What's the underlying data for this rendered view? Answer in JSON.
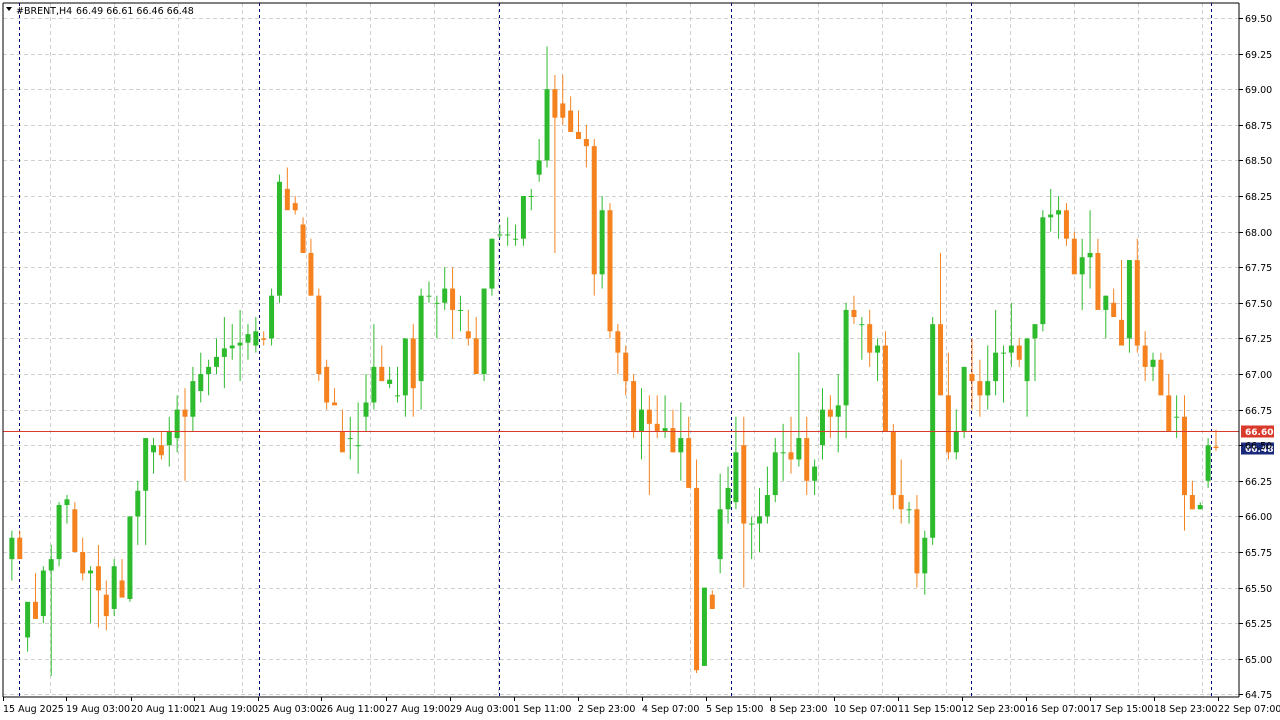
{
  "header": {
    "symbol_info": "#BRENT,H4",
    "ohlc": "66.49 66.61 66.46 66.48"
  },
  "colors": {
    "background": "#ffffff",
    "grid": "#d0d0d0",
    "bull": "#2dbb2d",
    "bear": "#f5821f",
    "separator": "#000080",
    "ask_line": "#d93a2b",
    "bid_tag": "#1a2a7a"
  },
  "price_tags": {
    "ask": "66.60",
    "bid": "66.48"
  },
  "chart_data": {
    "type": "candlestick",
    "title": "#BRENT,H4",
    "ylim": [
      64.7,
      69.6
    ],
    "grid": true,
    "y_ticks": [
      "69.50",
      "69.25",
      "69.00",
      "68.75",
      "68.50",
      "68.25",
      "68.00",
      "67.75",
      "67.50",
      "67.25",
      "67.00",
      "66.75",
      "66.50",
      "66.25",
      "66.00",
      "65.75",
      "65.50",
      "65.25",
      "65.00",
      "64.75"
    ],
    "x_labels": [
      "15 Aug 2025",
      "19 Aug 03:00",
      "20 Aug 11:00",
      "21 Aug 19:00",
      "25 Aug 03:00",
      "26 Aug 11:00",
      "27 Aug 19:00",
      "29 Aug 03:00",
      "1 Sep 11:00",
      "2 Sep 23:00",
      "4 Sep 07:00",
      "5 Sep 15:00",
      "8 Sep 23:00",
      "10 Sep 07:00",
      "11 Sep 15:00",
      "12 Sep 23:00",
      "16 Sep 07:00",
      "17 Sep 15:00",
      "18 Sep 23:00",
      "22 Sep 07:00"
    ],
    "ask_price": 66.6,
    "bid_price": 66.48,
    "candles": [
      [
        65.7,
        65.9,
        65.55,
        65.85
      ],
      [
        65.85,
        65.9,
        65.7,
        65.7
      ],
      [
        65.15,
        65.4,
        65.05,
        65.4
      ],
      [
        65.4,
        65.6,
        65.35,
        65.28
      ],
      [
        65.3,
        65.65,
        65.25,
        65.62
      ],
      [
        65.62,
        65.8,
        64.88,
        65.7
      ],
      [
        65.7,
        66.1,
        65.65,
        66.08
      ],
      [
        66.08,
        66.15,
        65.95,
        66.12
      ],
      [
        66.05,
        66.1,
        65.75,
        65.75
      ],
      [
        65.75,
        65.85,
        65.55,
        65.6
      ],
      [
        65.6,
        65.65,
        65.25,
        65.62
      ],
      [
        65.65,
        65.8,
        65.22,
        65.48
      ],
      [
        65.45,
        65.55,
        65.2,
        65.3
      ],
      [
        65.35,
        65.7,
        65.3,
        65.65
      ],
      [
        65.55,
        65.7,
        65.45,
        65.43
      ],
      [
        65.42,
        66.0,
        65.4,
        66.0
      ],
      [
        66.0,
        66.25,
        65.8,
        66.18
      ],
      [
        66.18,
        66.5,
        65.8,
        66.55
      ],
      [
        66.45,
        66.55,
        66.3,
        66.5
      ],
      [
        66.5,
        66.6,
        66.4,
        66.43
      ],
      [
        66.5,
        66.7,
        66.35,
        66.6
      ],
      [
        66.55,
        66.85,
        66.45,
        66.75
      ],
      [
        66.75,
        66.9,
        66.25,
        66.7
      ],
      [
        66.7,
        67.05,
        66.6,
        66.95
      ],
      [
        66.88,
        67.15,
        66.8,
        67.0
      ],
      [
        67.0,
        67.1,
        66.85,
        67.05
      ],
      [
        67.05,
        67.25,
        67.0,
        67.12
      ],
      [
        67.12,
        67.4,
        66.9,
        67.18
      ],
      [
        67.18,
        67.35,
        67.1,
        67.2
      ],
      [
        67.2,
        67.45,
        66.95,
        67.22
      ],
      [
        67.22,
        67.35,
        67.1,
        67.28
      ],
      [
        67.2,
        67.4,
        67.15,
        67.3
      ],
      [
        67.25,
        67.3,
        67.2,
        67.24
      ],
      [
        67.25,
        67.6,
        67.2,
        67.55
      ],
      [
        67.55,
        68.4,
        67.5,
        68.35
      ],
      [
        68.3,
        68.45,
        68.2,
        68.15
      ],
      [
        68.2,
        68.25,
        68.12,
        68.15
      ],
      [
        68.05,
        68.1,
        67.85,
        67.85
      ],
      [
        67.85,
        67.95,
        67.55,
        67.55
      ],
      [
        67.55,
        67.6,
        66.95,
        67.0
      ],
      [
        67.05,
        67.1,
        66.75,
        66.8
      ],
      [
        66.8,
        66.9,
        66.8,
        66.78
      ],
      [
        66.6,
        66.75,
        66.6,
        66.45
      ],
      [
        66.55,
        66.7,
        66.4,
        66.55
      ],
      [
        66.5,
        66.8,
        66.3,
        66.5
      ],
      [
        66.7,
        67.0,
        66.6,
        66.8
      ],
      [
        66.8,
        67.35,
        66.75,
        67.05
      ],
      [
        67.05,
        67.2,
        66.95,
        66.95
      ],
      [
        66.93,
        67.05,
        66.9,
        66.96
      ],
      [
        66.85,
        67.05,
        66.8,
        66.85
      ],
      [
        66.85,
        67.2,
        66.7,
        67.25
      ],
      [
        67.25,
        67.35,
        66.7,
        66.9
      ],
      [
        66.95,
        67.6,
        66.75,
        67.55
      ],
      [
        67.55,
        67.65,
        67.5,
        67.55
      ],
      [
        67.5,
        67.55,
        67.25,
        67.5
      ],
      [
        67.5,
        67.75,
        67.45,
        67.6
      ],
      [
        67.6,
        67.75,
        67.25,
        67.45
      ],
      [
        67.45,
        67.55,
        67.3,
        67.45
      ],
      [
        67.3,
        67.45,
        67.2,
        67.25
      ],
      [
        67.25,
        67.4,
        67.05,
        67.0
      ],
      [
        67.0,
        67.6,
        66.95,
        67.6
      ],
      [
        67.6,
        67.95,
        67.55,
        67.95
      ],
      [
        67.98,
        68.05,
        67.95,
        67.98
      ],
      [
        67.98,
        68.1,
        67.9,
        67.98
      ],
      [
        67.95,
        68.05,
        67.9,
        67.95
      ],
      [
        67.95,
        68.25,
        67.9,
        68.25
      ],
      [
        68.25,
        68.3,
        68.15,
        68.25
      ],
      [
        68.4,
        68.65,
        68.35,
        68.5
      ],
      [
        68.5,
        69.3,
        68.45,
        69.0
      ],
      [
        69.0,
        69.1,
        67.85,
        68.8
      ],
      [
        68.9,
        69.1,
        68.75,
        68.8
      ],
      [
        68.85,
        68.95,
        68.7,
        68.7
      ],
      [
        68.7,
        68.85,
        68.65,
        68.65
      ],
      [
        68.65,
        68.75,
        68.45,
        68.6
      ],
      [
        68.6,
        68.65,
        67.55,
        67.7
      ],
      [
        67.7,
        68.25,
        67.6,
        68.15
      ],
      [
        68.15,
        68.2,
        67.25,
        67.3
      ],
      [
        67.3,
        67.35,
        67.0,
        67.15
      ],
      [
        67.15,
        67.2,
        66.85,
        66.95
      ],
      [
        66.95,
        67.0,
        66.55,
        66.6
      ],
      [
        66.6,
        66.9,
        66.4,
        66.75
      ],
      [
        66.75,
        66.85,
        66.15,
        66.65
      ],
      [
        66.65,
        66.85,
        66.55,
        66.6
      ],
      [
        66.6,
        66.85,
        66.55,
        66.62
      ],
      [
        66.62,
        66.75,
        66.45,
        66.45
      ],
      [
        66.45,
        66.8,
        66.25,
        66.55
      ],
      [
        66.55,
        66.7,
        66.2,
        66.2
      ],
      [
        66.2,
        66.4,
        64.9,
        64.92
      ],
      [
        64.95,
        65.5,
        64.95,
        65.5
      ],
      [
        65.45,
        65.48,
        65.35,
        65.35
      ],
      [
        65.7,
        66.3,
        65.6,
        66.05
      ],
      [
        66.05,
        66.35,
        65.95,
        66.2
      ],
      [
        66.1,
        66.7,
        66.05,
        66.45
      ],
      [
        66.5,
        66.7,
        65.5,
        65.95
      ],
      [
        65.95,
        66.0,
        65.7,
        65.95
      ],
      [
        65.95,
        66.2,
        65.75,
        66.0
      ],
      [
        66.0,
        66.35,
        65.95,
        66.15
      ],
      [
        66.15,
        66.55,
        66.1,
        66.45
      ],
      [
        66.45,
        66.65,
        66.25,
        66.45
      ],
      [
        66.45,
        66.7,
        66.3,
        66.4
      ],
      [
        66.4,
        67.15,
        66.35,
        66.55
      ],
      [
        66.55,
        66.7,
        66.15,
        66.25
      ],
      [
        66.25,
        66.4,
        66.15,
        66.35
      ],
      [
        66.5,
        66.9,
        66.4,
        66.75
      ],
      [
        66.75,
        66.85,
        66.55,
        66.7
      ],
      [
        66.7,
        67.0,
        66.45,
        66.78
      ],
      [
        66.78,
        67.5,
        66.55,
        67.45
      ],
      [
        67.45,
        67.55,
        67.35,
        67.4
      ],
      [
        67.35,
        67.4,
        67.1,
        67.35
      ],
      [
        67.35,
        67.45,
        67.05,
        67.15
      ],
      [
        67.15,
        67.25,
        66.95,
        67.2
      ],
      [
        67.2,
        67.3,
        66.6,
        66.6
      ],
      [
        66.6,
        66.65,
        66.05,
        66.15
      ],
      [
        66.15,
        66.4,
        65.95,
        66.05
      ],
      [
        66.05,
        66.1,
        65.95,
        66.05
      ],
      [
        66.05,
        66.15,
        65.5,
        65.6
      ],
      [
        65.6,
        65.9,
        65.45,
        65.85
      ],
      [
        65.85,
        67.4,
        65.8,
        67.35
      ],
      [
        67.35,
        67.85,
        66.95,
        66.85
      ],
      [
        66.85,
        67.15,
        66.4,
        66.45
      ],
      [
        66.45,
        66.75,
        66.4,
        66.6
      ],
      [
        66.6,
        67.05,
        66.55,
        67.05
      ],
      [
        67.0,
        67.25,
        66.75,
        66.95
      ],
      [
        66.95,
        67.1,
        66.7,
        66.85
      ],
      [
        66.85,
        67.2,
        66.75,
        66.95
      ],
      [
        66.95,
        67.45,
        66.85,
        67.15
      ],
      [
        67.15,
        67.2,
        66.8,
        67.15
      ],
      [
        67.15,
        67.5,
        67.05,
        67.2
      ],
      [
        67.2,
        67.25,
        67.05,
        67.1
      ],
      [
        66.95,
        67.25,
        66.7,
        67.25
      ],
      [
        67.25,
        67.35,
        66.95,
        67.35
      ],
      [
        67.35,
        68.15,
        67.3,
        68.1
      ],
      [
        68.1,
        68.3,
        68.0,
        68.12
      ],
      [
        68.12,
        68.25,
        67.95,
        68.15
      ],
      [
        68.15,
        68.2,
        67.9,
        67.95
      ],
      [
        67.95,
        68.0,
        67.7,
        67.7
      ],
      [
        67.7,
        67.95,
        67.45,
        67.82
      ],
      [
        67.82,
        68.15,
        67.6,
        67.85
      ],
      [
        67.85,
        67.95,
        67.45,
        67.45
      ],
      [
        67.45,
        67.55,
        67.25,
        67.55
      ],
      [
        67.5,
        67.6,
        67.4,
        67.4
      ],
      [
        67.38,
        67.8,
        67.2,
        67.2
      ],
      [
        67.25,
        67.8,
        67.15,
        67.8
      ],
      [
        67.8,
        67.95,
        67.15,
        67.2
      ],
      [
        67.2,
        67.3,
        66.95,
        67.05
      ],
      [
        67.05,
        67.15,
        66.95,
        67.1
      ],
      [
        67.1,
        67.15,
        66.85,
        66.85
      ],
      [
        66.85,
        67.0,
        66.75,
        66.6
      ],
      [
        66.7,
        66.85,
        66.55,
        66.7
      ],
      [
        66.7,
        66.85,
        65.9,
        66.15
      ],
      [
        66.15,
        66.25,
        66.05,
        66.05
      ],
      [
        66.05,
        66.1,
        66.05,
        66.08
      ],
      [
        66.25,
        66.55,
        66.2,
        66.5
      ],
      [
        66.49,
        66.61,
        66.46,
        66.48
      ]
    ]
  }
}
